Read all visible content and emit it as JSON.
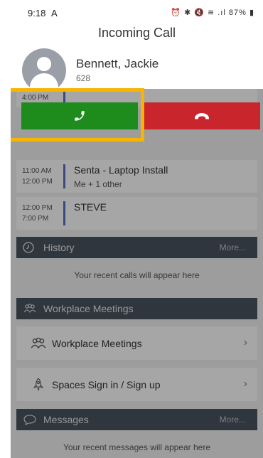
{
  "status_bar": {
    "time": "9:18",
    "carrier_icon": "A",
    "icons_text": "⏰ ✱ 🔇 ≋ .ıl 87% ▮",
    "battery": "87%"
  },
  "call": {
    "title": "Incoming Call",
    "caller_name": "Bennett, Jackie",
    "caller_extension": "628",
    "answer_icon": "phone-icon",
    "decline_icon": "phone-hangup-icon",
    "answer_color": "#1d8c1d",
    "decline_color": "#c8252c",
    "highlight_color": "#f7b500"
  },
  "calendar": {
    "partial_time": "4:00 PM",
    "events": [
      {
        "start": "11:00 AM",
        "end": "12:00 PM",
        "title": "Senta - Laptop Install",
        "attendees": "Me + 1 other"
      },
      {
        "start": "12:00 PM",
        "end": "7:00 PM",
        "title": "STEVE",
        "attendees": ""
      }
    ]
  },
  "history": {
    "header": "History",
    "more": "More...",
    "empty": "Your recent calls will appear here"
  },
  "meetings": {
    "header": "Workplace Meetings",
    "items": [
      {
        "label": "Workplace Meetings",
        "icon": "people-icon"
      },
      {
        "label": "Spaces Sign in / Sign up",
        "icon": "rocket-icon"
      }
    ]
  },
  "messages": {
    "header": "Messages",
    "more": "More...",
    "empty": "Your recent messages will appear here"
  }
}
